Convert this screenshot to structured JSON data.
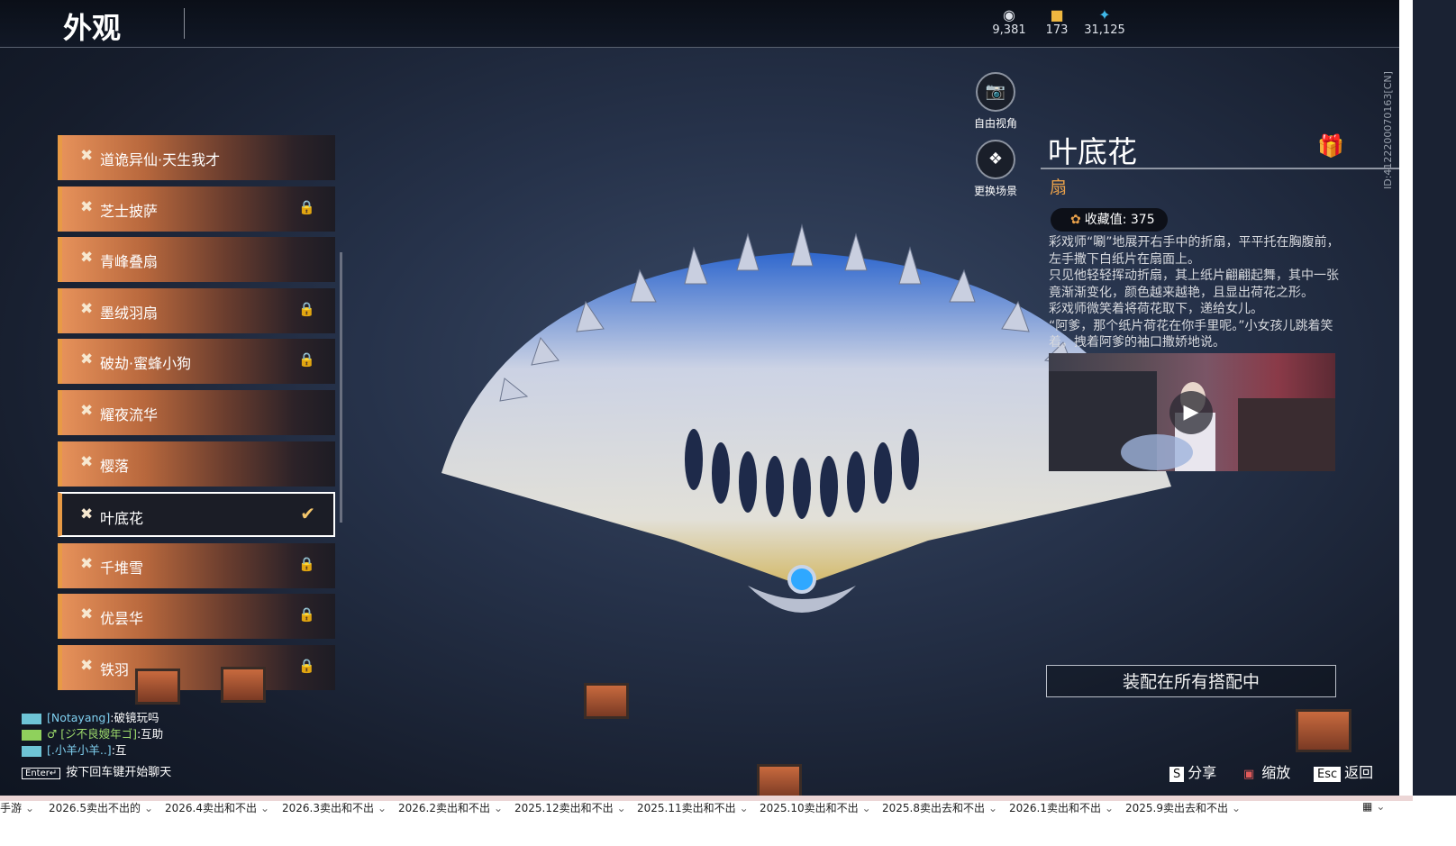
{
  "header": {
    "title": "外观"
  },
  "currencies": [
    {
      "icon": "bean-icon",
      "value": "9,381"
    },
    {
      "icon": "gold-chest-icon",
      "value": "173"
    },
    {
      "icon": "feather-icon",
      "value": "31,125"
    }
  ],
  "outfit_list": [
    {
      "name": "道诡异仙·天生我才",
      "locked": false
    },
    {
      "name": "芝士披萨",
      "locked": true
    },
    {
      "name": "青峰叠扇",
      "locked": false
    },
    {
      "name": "墨绒羽扇",
      "locked": true
    },
    {
      "name": "破劫·蜜蜂小狗",
      "locked": true
    },
    {
      "name": "耀夜流华",
      "locked": false
    },
    {
      "name": "樱落",
      "locked": false
    },
    {
      "name": "叶底花",
      "locked": false,
      "selected": true
    },
    {
      "name": "千堆雪",
      "locked": true
    },
    {
      "name": "优昙华",
      "locked": true
    },
    {
      "name": "铁羽",
      "locked": true
    }
  ],
  "camera_buttons": {
    "free_view": "自由视角",
    "change_scene": "更换场景"
  },
  "detail": {
    "name": "叶底花",
    "type": "扇",
    "collect_value": "收藏值: 375",
    "description": [
      "彩戏师“唰”地展开右手中的折扇，平平托在胸腹前，左手撒下白纸片在扇面上。",
      "只见他轻轻挥动折扇，其上纸片翩翩起舞，其中一张竟渐渐变化，颜色越来越艳，且显出荷花之形。",
      "彩戏师微笑着将荷花取下，递给女儿。",
      "“阿爹，那个纸片荷花在你手里呢。”小女孩儿跳着笑着，拽着阿爹的袖口撒娇地说。"
    ],
    "equip_button": "装配在所有搭配中"
  },
  "side_id": "ID:4122200070163[CN]",
  "chat": [
    {
      "user": "[Notayang]",
      "msg": ":破镜玩吗"
    },
    {
      "user": "[ジ不良嫂年ゴ]",
      "msg": ":互助",
      "gender": "♂"
    },
    {
      "user": "[.小羊小羊..]",
      "msg": ":互"
    }
  ],
  "chat_hint": {
    "key": "Enter↵",
    "text": "按下回车键开始聊天"
  },
  "hotkeys": [
    {
      "key": "S",
      "label": "分享"
    },
    {
      "key": "▣",
      "label": "缩放"
    },
    {
      "key": "Esc",
      "label": "返回"
    }
  ],
  "taskbar": {
    "first": "手游",
    "tabs": [
      "2026.5卖出不出的",
      "2026.4卖出和不出",
      "2026.3卖出和不出",
      "2026.2卖出和不出",
      "2025.12卖出和不出",
      "2025.11卖出和不出",
      "2025.10卖出和不出",
      "2025.8卖出去和不出",
      "2026.1卖出和不出",
      "2025.9卖出去和不出"
    ]
  },
  "colors": {
    "accent": "#e89a45",
    "panel_bg": "#1b1d26"
  }
}
